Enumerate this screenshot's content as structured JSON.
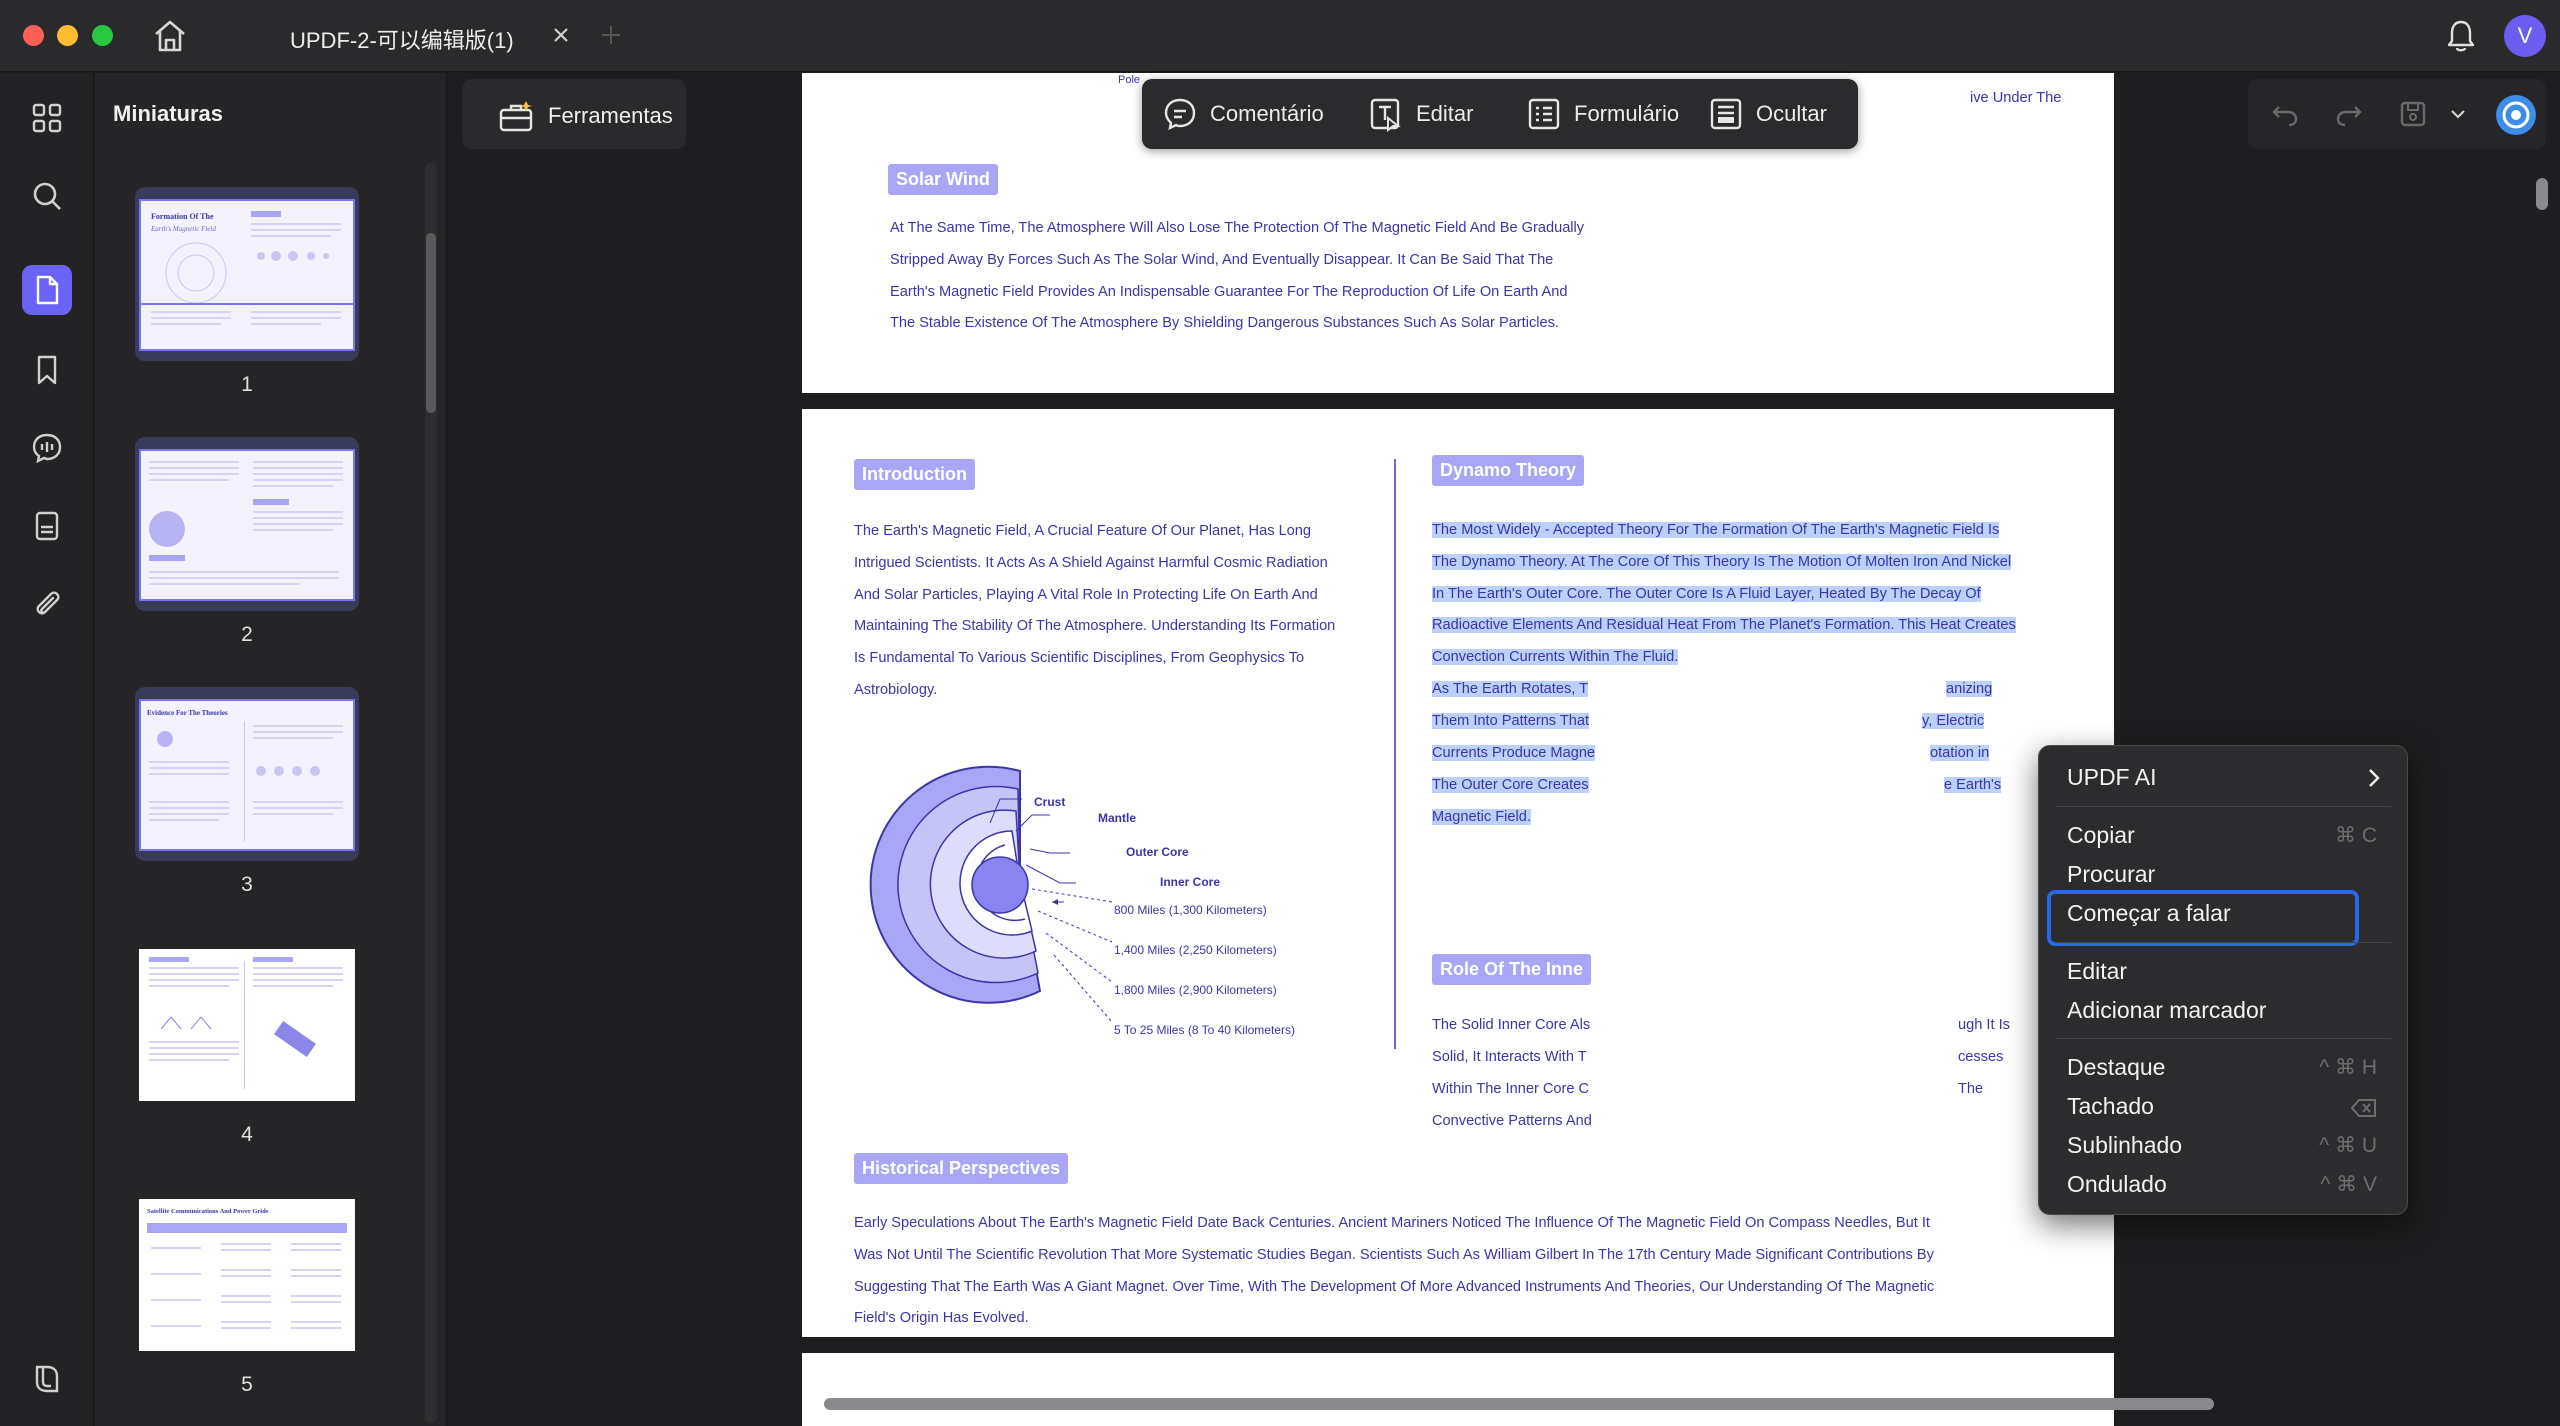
{
  "titlebar": {
    "tab_title": "UPDF-2-可以编辑版(1)",
    "avatar_letter": "V"
  },
  "sidebar": {
    "title": "Miniaturas",
    "pages": [
      "1",
      "2",
      "3",
      "4",
      "5"
    ]
  },
  "toolbar": {
    "tools_label": "Ferramentas",
    "modes": [
      "Comentário",
      "Editar",
      "Formulário",
      "Ocultar"
    ]
  },
  "document": {
    "top_fragment_left": "Pole",
    "top_fragment_right": "ive Under The",
    "solar_wind_title": "Solar Wind",
    "solar_wind_lines": [
      "At The Same Time, The Atmosphere Will Also Lose The Protection Of The Magnetic Field And Be Gradually",
      "Stripped Away By Forces Such As The Solar Wind, And Eventually Disappear. It Can Be Said That The",
      "Earth's Magnetic Field Provides An Indispensable Guarantee For The Reproduction Of Life On Earth And",
      "The Stable Existence Of The Atmosphere By Shielding Dangerous Substances Such As Solar Particles."
    ],
    "intro_title": "Introduction",
    "intro_lines": [
      "The Earth's Magnetic Field, A Crucial Feature Of Our Planet, Has Long",
      "Intrigued Scientists. It Acts As A Shield Against Harmful Cosmic Radiation",
      "And Solar Particles, Playing A Vital Role In Protecting Life On Earth And",
      "Maintaining The Stability Of The Atmosphere. Understanding Its Formation",
      "Is Fundamental To Various Scientific Disciplines, From Geophysics To",
      "Astrobiology."
    ],
    "diagram": {
      "labels": [
        "Crust",
        "Mantle",
        "Outer Core",
        "Inner Core"
      ],
      "depths": [
        "800 Miles (1,300 Kilometers)",
        "1,400 Miles (2,250 Kilometers)",
        "1,800 Miles (2,900 Kilometers)",
        "5 To 25 Miles (8 To 40 Kilometers)"
      ]
    },
    "dynamo_title": "Dynamo Theory",
    "dynamo_lines": [
      "The Most Widely - Accepted Theory For The Formation Of The Earth's Magnetic Field Is",
      "The Dynamo Theory. At The Core Of This Theory Is The Motion Of Molten Iron And Nickel",
      "In The Earth's Outer Core. The Outer Core Is A Fluid Layer, Heated By The Decay Of",
      "Radioactive Elements And Residual Heat From The Planet's Formation. This Heat Creates",
      "Convection Currents Within The Fluid."
    ],
    "dynamo_cont_left": [
      "As The Earth Rotates, T",
      "Them Into Patterns That",
      "Currents Produce Magne",
      "The Outer Core Creates",
      "Magnetic Field."
    ],
    "dynamo_cont_right": [
      "anizing",
      "y, Electric",
      "otation in",
      "e Earth's"
    ],
    "inner_title": "Role Of The Inne",
    "inner_left": [
      "The Solid Inner Core Als",
      "Solid, It Interacts With T",
      "Within The Inner Core C",
      "Convective Patterns And"
    ],
    "inner_right": [
      "ugh It Is",
      "cesses",
      "The"
    ],
    "history_title": "Historical Perspectives",
    "history_lines": [
      "Early Speculations About The Earth's Magnetic Field Date Back Centuries. Ancient Mariners Noticed The Influence Of The Magnetic Field On Compass Needles, But It",
      "Was Not Until The Scientific Revolution That More Systematic Studies Began. Scientists Such As William Gilbert In The 17th Century Made Significant Contributions By",
      "Suggesting That The Earth Was A Giant Magnet. Over Time, With The Development Of More Advanced Instruments And Theories, Our Understanding Of The Magnetic",
      "Field's Origin Has Evolved."
    ]
  },
  "context_menu": {
    "updf_ai": "UPDF AI",
    "copy": "Copiar",
    "copy_shortcut": "⌘ C",
    "search": "Procurar",
    "speak": "Começar a falar",
    "edit": "Editar",
    "bookmark": "Adicionar marcador",
    "highlight": "Destaque",
    "highlight_shortcut": "^ ⌘ H",
    "strike": "Tachado",
    "underline": "Sublinhado",
    "underline_shortcut": "^ ⌘ U",
    "squiggly": "Ondulado",
    "squiggly_shortcut": "^ ⌘ V"
  },
  "colors": {
    "accent": "#6b63f6",
    "text_purple": "#3b35a8",
    "pill": "#a9a6f5",
    "selection": "#bad1f8",
    "focus_ring": "#2a66e8"
  }
}
